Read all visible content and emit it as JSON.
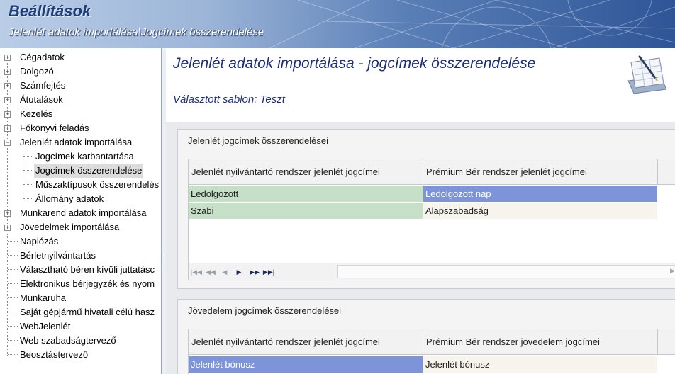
{
  "header": {
    "app_title": "Beállítások",
    "breadcrumb": "Jelenlét adatok importálása\\Jogcímek összerendelése"
  },
  "sidebar": {
    "items": [
      {
        "label": "Cégadatok",
        "expander": "+"
      },
      {
        "label": "Dolgozó",
        "expander": "+"
      },
      {
        "label": "Számfejtés",
        "expander": "+"
      },
      {
        "label": "Átutalások",
        "expander": "+"
      },
      {
        "label": "Kezelés",
        "expander": "+"
      },
      {
        "label": "Főkönyvi feladás",
        "expander": "+"
      },
      {
        "label": "Jelenlét adatok importálása",
        "expander": "−"
      },
      {
        "label": "Jogcímek karbantartása",
        "child": true
      },
      {
        "label": "Jogcímek összerendelése",
        "child": true,
        "selected": true
      },
      {
        "label": "Műszaktípusok összerendelés",
        "child": true
      },
      {
        "label": "Állomány adatok",
        "child": true
      },
      {
        "label": "Munkarend adatok importálása",
        "expander": "+"
      },
      {
        "label": "Jövedelmek importálása",
        "expander": "+"
      },
      {
        "label": "Naplózás"
      },
      {
        "label": "Bérletnyilvántartás"
      },
      {
        "label": "Választható béren kívüli juttatásc"
      },
      {
        "label": "Elektronikus bérjegyzék és nyom"
      },
      {
        "label": "Munkaruha"
      },
      {
        "label": "Saját gépjármű hivatali célú hasz"
      },
      {
        "label": "WebJelenlét"
      },
      {
        "label": "Web szabadságtervező"
      },
      {
        "label": "Beosztástervező"
      }
    ]
  },
  "main": {
    "title": "Jelenlét adatok importálása - jogcímek összerendelése",
    "template_line": "Választott sablon: Teszt",
    "header_icon": "calendar-pen-icon",
    "panel1": {
      "title": "Jelenlét jogcímek összerendelései",
      "columns": [
        "Jelenlét nyilvántartó rendszer jelenlét jogcímei",
        "Prémium Bér rendszer jelenlét jogcímei"
      ],
      "rows": [
        {
          "left": "Ledolgozott",
          "right": "Ledolgozott nap"
        },
        {
          "left": "Szabi",
          "right": "Alapszabadság"
        }
      ],
      "nav_icons": [
        "first-icon",
        "prev-page-icon",
        "prev-icon",
        "next-icon",
        "next-page-icon",
        "last-icon"
      ]
    },
    "panel2": {
      "title": "Jövedelem jogcímek összerendelései",
      "columns": [
        "Jelenlét nyilvántartó rendszer jelenlét jogcímei",
        "Prémium Bér rendszer jövedelem jogcímei"
      ],
      "rows": [
        {
          "left": "Jelenlét bónusz",
          "right": "Jelenlét bónusz"
        }
      ]
    }
  },
  "colors": {
    "title_blue": "#1d2d7a",
    "row_green": "#c6dfc7",
    "row_selected_blue": "#7d95d8"
  }
}
